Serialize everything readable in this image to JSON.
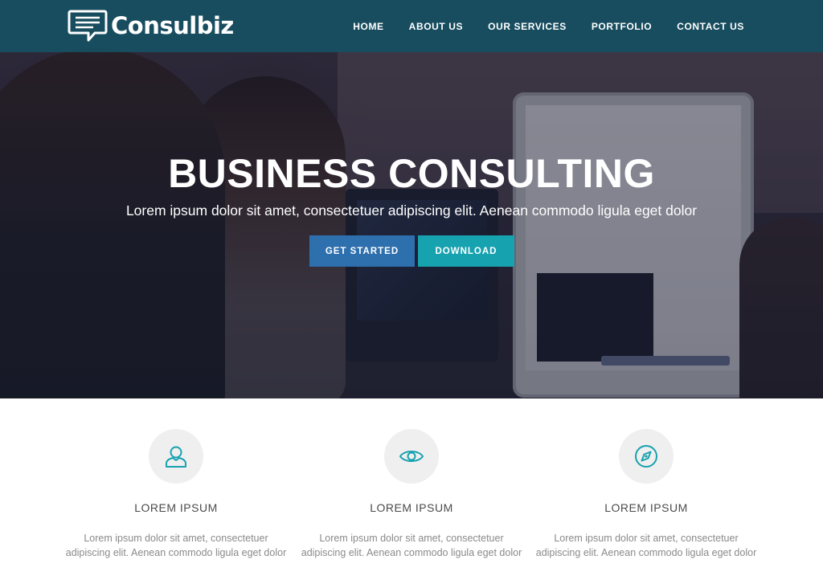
{
  "brand": {
    "name": "Consulbiz"
  },
  "nav": {
    "items": [
      {
        "label": "HOME"
      },
      {
        "label": "ABOUT US"
      },
      {
        "label": "OUR SERVICES"
      },
      {
        "label": "PORTFOLIO"
      },
      {
        "label": "CONTACT US"
      }
    ]
  },
  "hero": {
    "title": "BUSINESS CONSULTING",
    "subtitle": "Lorem ipsum dolor sit amet, consectetuer adipiscing elit. Aenean commodo ligula eget dolor",
    "primary_button": "GET STARTED",
    "secondary_button": "DOWNLOAD"
  },
  "features": [
    {
      "icon": "user-icon",
      "title": "LOREM IPSUM",
      "text": "Lorem ipsum dolor sit amet, consectetuer adipiscing elit. Aenean commodo ligula eget dolor"
    },
    {
      "icon": "eye-icon",
      "title": "LOREM IPSUM",
      "text": "Lorem ipsum dolor sit amet, consectetuer adipiscing elit. Aenean commodo ligula eget dolor"
    },
    {
      "icon": "compass-icon",
      "title": "LOREM IPSUM",
      "text": "Lorem ipsum dolor sit amet, consectetuer adipiscing elit. Aenean commodo ligula eget dolor"
    }
  ],
  "colors": {
    "navbar": "#165264",
    "primary_button": "#2e6fae",
    "secondary_button": "#17a2b0",
    "icon_accent": "#17a2b0",
    "feature_circle": "#efefef"
  }
}
